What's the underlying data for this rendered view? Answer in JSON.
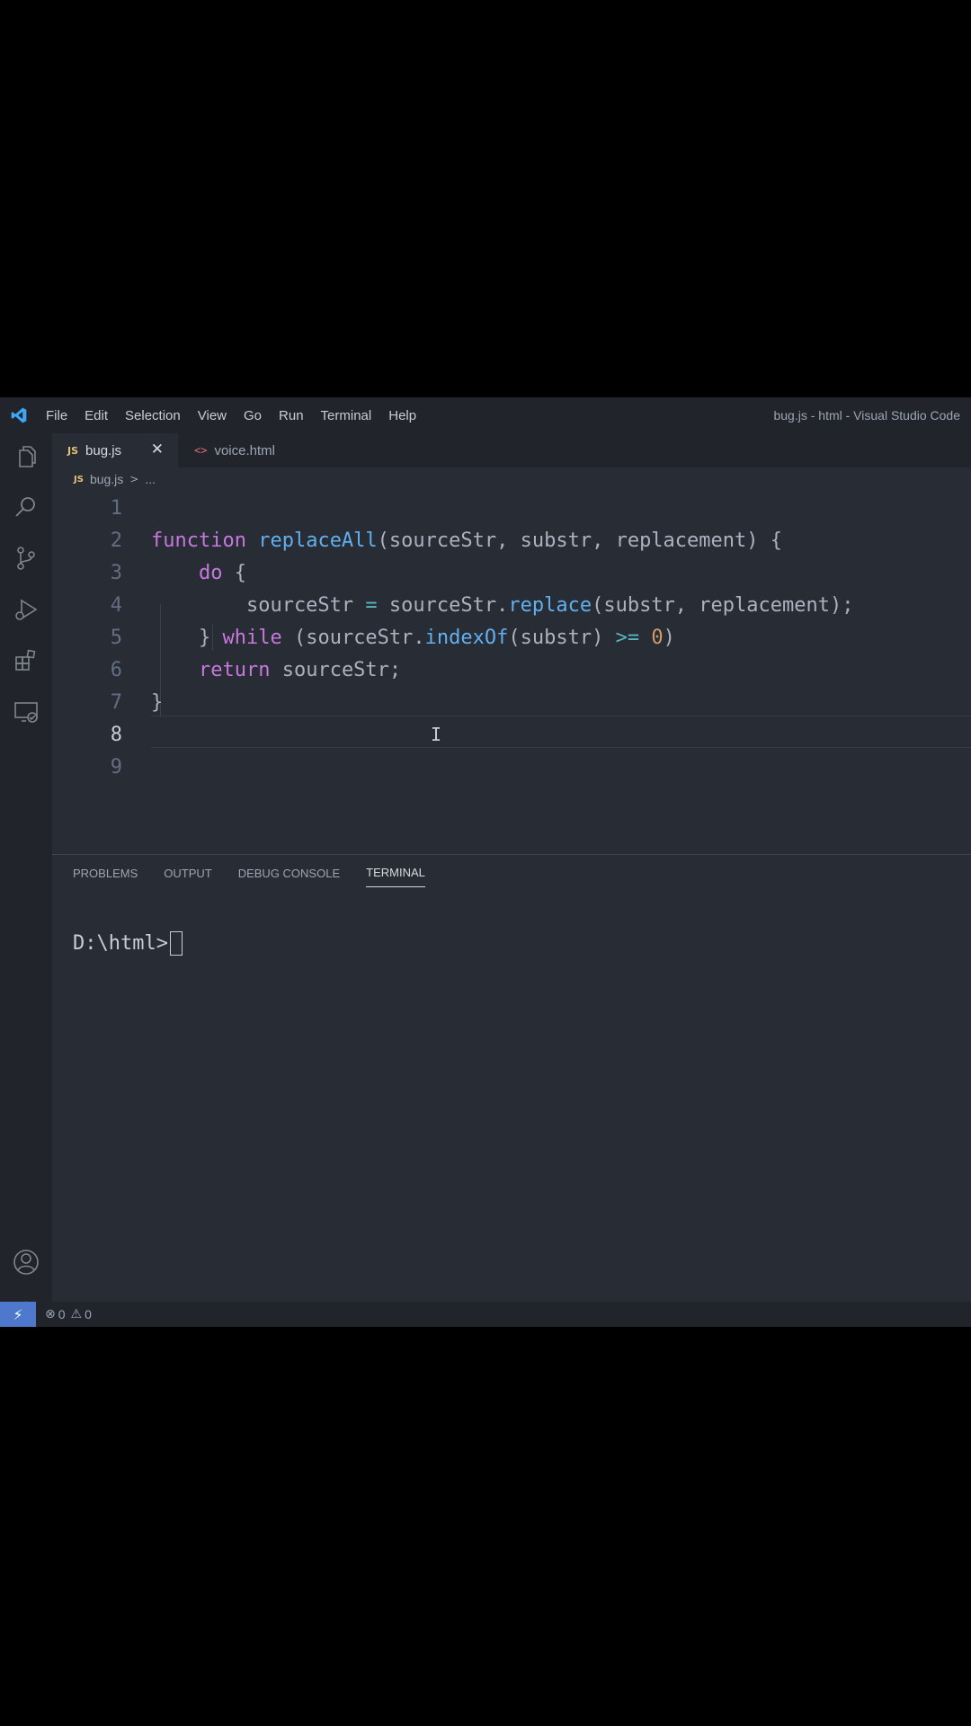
{
  "titlebar": {
    "menu": [
      "File",
      "Edit",
      "Selection",
      "View",
      "Go",
      "Run",
      "Terminal",
      "Help"
    ],
    "window_title": "bug.js - html - Visual Studio Code"
  },
  "activity_bar": {
    "top_icons": [
      "explorer-icon",
      "search-icon",
      "source-control-icon",
      "run-debug-icon",
      "extensions-icon",
      "remote-explorer-icon"
    ],
    "bottom_icons": [
      "account-icon",
      "manage-gear-icon"
    ]
  },
  "tabs": [
    {
      "badge": "JS",
      "label": "bug.js",
      "active": true,
      "close": "✕"
    },
    {
      "badge": "<>",
      "label": "voice.html",
      "active": false
    }
  ],
  "breadcrumb": {
    "badge": "JS",
    "file": "bug.js",
    "separator": ">",
    "trail": "..."
  },
  "editor": {
    "line_numbers": [
      "1",
      "2",
      "3",
      "4",
      "5",
      "6",
      "7",
      "8",
      "9"
    ],
    "active_line": 8,
    "lines": [
      [],
      [
        {
          "t": "function",
          "c": "kw"
        },
        {
          "t": " "
        },
        {
          "t": "replaceAll",
          "c": "fn"
        },
        {
          "t": "(sourceStr, substr, replacement) {"
        }
      ],
      [
        {
          "t": "    "
        },
        {
          "t": "do",
          "c": "kw"
        },
        {
          "t": " {"
        }
      ],
      [
        {
          "t": "        sourceStr "
        },
        {
          "t": "=",
          "c": "op"
        },
        {
          "t": " sourceStr."
        },
        {
          "t": "replace",
          "c": "fn"
        },
        {
          "t": "(substr, replacement);"
        }
      ],
      [
        {
          "t": "    } "
        },
        {
          "t": "while",
          "c": "kw"
        },
        {
          "t": " (sourceStr."
        },
        {
          "t": "indexOf",
          "c": "fn"
        },
        {
          "t": "(substr) "
        },
        {
          "t": ">=",
          "c": "op"
        },
        {
          "t": " "
        },
        {
          "t": "0",
          "c": "num"
        },
        {
          "t": ")"
        }
      ],
      [
        {
          "t": "    "
        },
        {
          "t": "return",
          "c": "kw"
        },
        {
          "t": " sourceStr;"
        }
      ],
      [
        {
          "t": "}"
        }
      ],
      [],
      []
    ]
  },
  "panel": {
    "tabs": [
      "PROBLEMS",
      "OUTPUT",
      "DEBUG CONSOLE",
      "TERMINAL"
    ],
    "active_tab": "TERMINAL",
    "terminal_prompt": "D:\\html>"
  },
  "statusbar": {
    "remote": "⚡",
    "errors": "0",
    "warnings": "0"
  },
  "colors": {
    "accent": "#4d78cc",
    "keyword": "#c678dd",
    "function": "#61afef",
    "number": "#d19a66",
    "operator": "#56b6c2"
  }
}
